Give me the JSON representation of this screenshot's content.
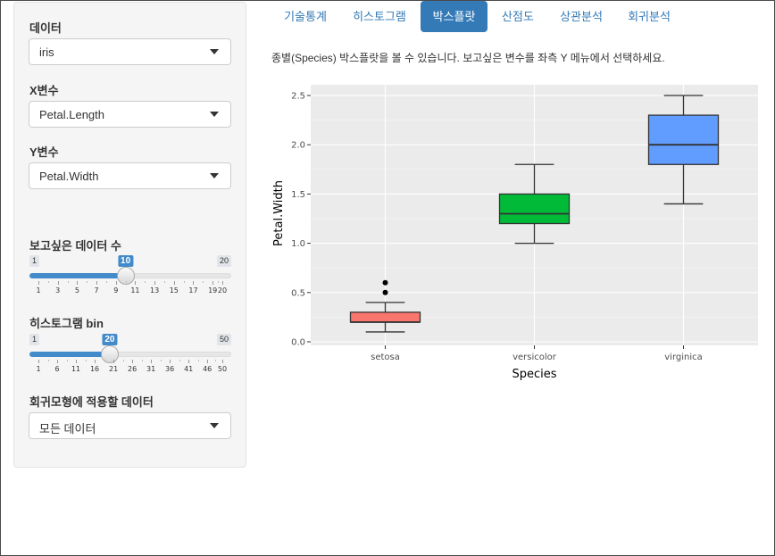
{
  "sidebar": {
    "data_label": "데이터",
    "data_value": "iris",
    "x_label": "X변수",
    "x_value": "Petal.Length",
    "y_label": "Y변수",
    "y_value": "Petal.Width",
    "n_label": "보고싶은 데이터 수",
    "n_slider": {
      "min": "1",
      "max": "20",
      "value": "10",
      "value_num": 10,
      "min_num": 1,
      "max_num": 20,
      "tick_labels": [
        "1",
        "3",
        "5",
        "7",
        "9",
        "11",
        "13",
        "15",
        "17",
        "19",
        "20"
      ]
    },
    "bin_label": "히스토그램 bin",
    "bin_slider": {
      "min": "1",
      "max": "50",
      "value": "20",
      "value_num": 20,
      "min_num": 1,
      "max_num": 50,
      "tick_labels": [
        "1",
        "6",
        "11",
        "16",
        "21",
        "26",
        "31",
        "36",
        "41",
        "46",
        "50"
      ]
    },
    "reg_label": "회귀모형에 적용할 데이터",
    "reg_value": "모든 데이터"
  },
  "tabs": [
    "기술통계",
    "히스토그램",
    "박스플랏",
    "산점도",
    "상관분석",
    "회귀분석"
  ],
  "active_tab": "박스플랏",
  "description": "종별(Species) 박스플랏을 볼 수 있습니다. 보고싶은 변수를 좌측 Y 메뉴에서 선택하세요.",
  "chart_data": {
    "type": "boxplot",
    "title": "",
    "xlabel": "Species",
    "ylabel": "Petal.Width",
    "ylim": [
      0,
      2.6
    ],
    "yticks": [
      "0.0",
      "0.5",
      "1.0",
      "1.5",
      "2.0",
      "2.5"
    ],
    "categories": [
      "setosa",
      "versicolor",
      "virginica"
    ],
    "boxes": [
      {
        "category": "setosa",
        "min": 0.1,
        "q1": 0.2,
        "median": 0.2,
        "q3": 0.3,
        "max": 0.4,
        "outliers": [
          0.5,
          0.6
        ],
        "color": "#F8766D"
      },
      {
        "category": "versicolor",
        "min": 1.0,
        "q1": 1.2,
        "median": 1.3,
        "q3": 1.5,
        "max": 1.8,
        "outliers": [],
        "color": "#00BA38"
      },
      {
        "category": "virginica",
        "min": 1.4,
        "q1": 1.8,
        "median": 2.0,
        "q3": 2.3,
        "max": 2.5,
        "outliers": [],
        "color": "#619CFF"
      }
    ],
    "grid": true,
    "panel_background": "#EBEBEB"
  },
  "colors": {
    "accent": "#337ab7",
    "slider_blue": "#428bca"
  }
}
